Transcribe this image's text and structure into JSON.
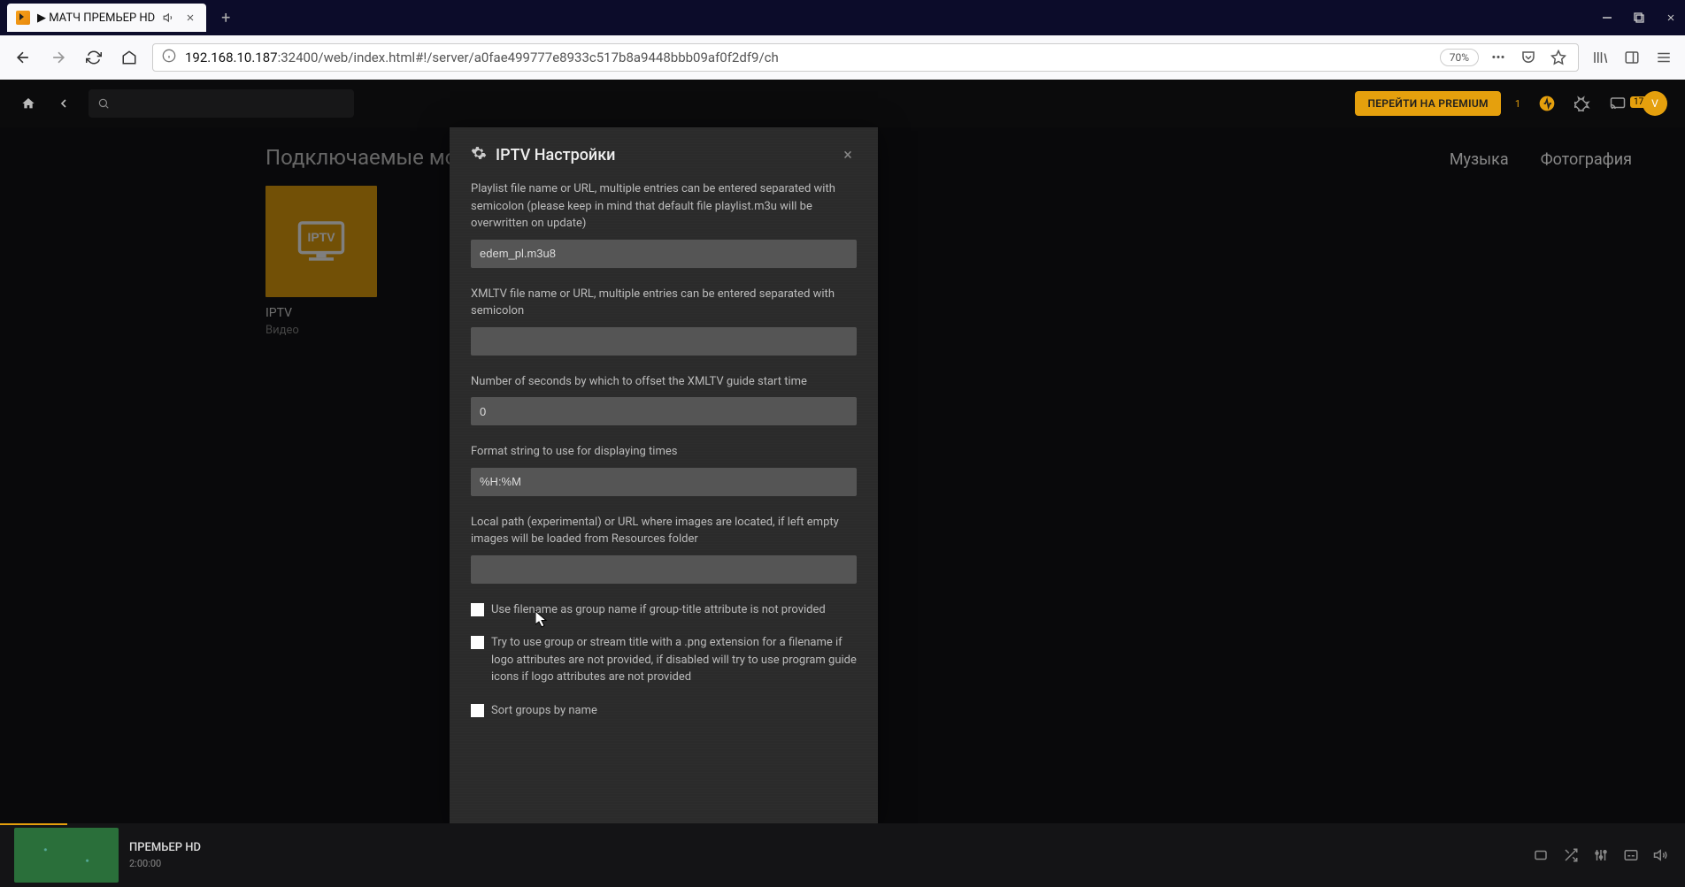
{
  "browser": {
    "tab_title": "▶ МАТЧ ПРЕМЬЕР HD",
    "url_prefix": "192.168.10.187",
    "url_rest": ":32400/web/index.html#!/server/a0fae499777e8933c517b8a9448bbb09af0f2df9/ch",
    "zoom": "70%"
  },
  "plex_header": {
    "premium": "ПЕРЕЙТИ НА PREMIUM",
    "activity_count": "1",
    "avatar_letter": "V",
    "avatar_badge": "17"
  },
  "page": {
    "section_title": "Подключаемые моду",
    "tabs": [
      "Музыка",
      "Фотография"
    ]
  },
  "plugin": {
    "name": "IPTV",
    "category": "Видео"
  },
  "modal": {
    "title": "IPTV Настройки",
    "fields": {
      "playlist": {
        "label": "Playlist file name or URL, multiple entries can be entered separated with semicolon (please keep in mind that default file playlist.m3u will be overwritten on update)",
        "value": "edem_pl.m3u8"
      },
      "xmltv": {
        "label": "XMLTV file name or URL, multiple entries can be entered separated with semicolon",
        "value": ""
      },
      "offset": {
        "label": "Number of seconds by which to offset the XMLTV guide start time",
        "value": "0"
      },
      "format": {
        "label": "Format string to use for displaying times",
        "value": "%H:%M"
      },
      "localpath": {
        "label": "Local path (experimental) or URL where images are located, if left empty images will be loaded from Resources folder",
        "value": ""
      }
    },
    "checkboxes": {
      "use_filename": "Use filename as group name if group-title attribute is not provided",
      "try_group": "Try to use group or stream title with a .png extension for a filename if logo attributes are not provided, if disabled will try to use program guide icons if logo attributes are not provided",
      "sort_groups": "Sort groups by name"
    }
  },
  "player": {
    "title": "ПРЕМЬЕР HD",
    "time": "2:00:00"
  }
}
